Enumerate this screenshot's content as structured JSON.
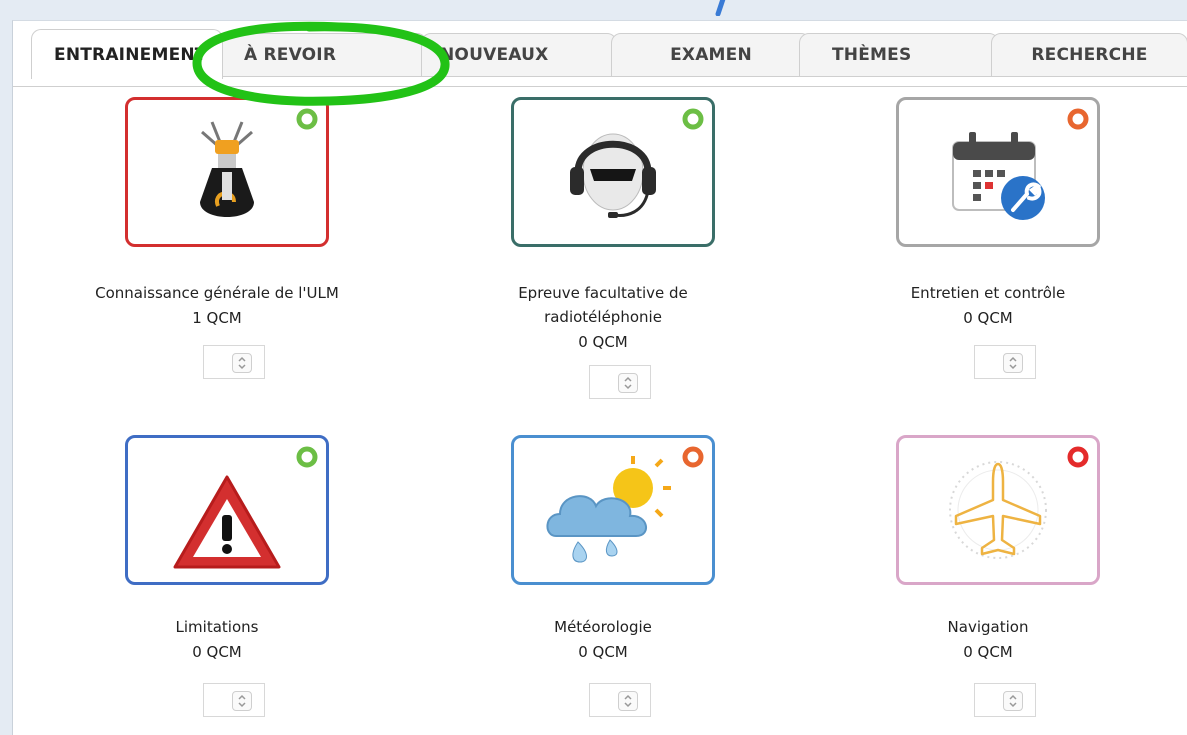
{
  "tabs": [
    "ENTRAINEMENT",
    "À REVOIR",
    "NOUVEAUX",
    "EXAMEN",
    "THÈMES",
    "RECHERCHE"
  ],
  "active_tab": "ENTRAINEMENT",
  "colors": {
    "annotation_circle": "#22c216",
    "status_green": "#6cbe45",
    "status_orange": "#e8662f",
    "status_red": "#e42b2b"
  },
  "categories": [
    {
      "title": "Connaissance générale de l'ULM",
      "title2": "",
      "count": "1 QCM",
      "border": "#d32f2f",
      "status": "green",
      "icon": "engine-icon"
    },
    {
      "title": "Epreuve facultative de",
      "title2": "radiotéléphonie",
      "count": "0 QCM",
      "border": "#3a6e68",
      "status": "green",
      "icon": "headset-pilot-icon"
    },
    {
      "title": "Entretien et contrôle",
      "title2": "",
      "count": "0 QCM",
      "border": "#a6a6a6",
      "status": "orange",
      "icon": "calendar-wrench-icon"
    },
    {
      "title": "Limitations",
      "title2": "",
      "count": "0 QCM",
      "border": "#3f6dc4",
      "status": "green",
      "icon": "warning-icon"
    },
    {
      "title": "Météorologie",
      "title2": "",
      "count": "0 QCM",
      "border": "#4a8fd0",
      "status": "orange",
      "icon": "weather-icon"
    },
    {
      "title": "Navigation",
      "title2": "",
      "count": "0 QCM",
      "border": "#d9a6c8",
      "status": "red",
      "icon": "compass-plane-icon"
    }
  ]
}
